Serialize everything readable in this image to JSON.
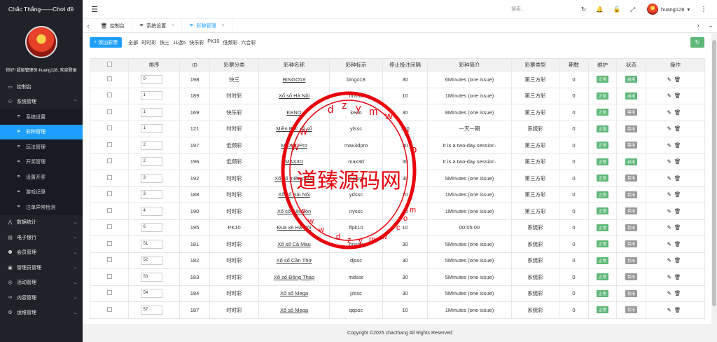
{
  "app": {
    "title": "Chắc Thắng——Chơi đề"
  },
  "sidebar": {
    "welcome": "你好! 超级管理员-huang128, 欢迎登录",
    "items": [
      {
        "label": "控制台",
        "icon": "monitor-icon",
        "expandable": false
      },
      {
        "label": "系统管理",
        "icon": "user-icon",
        "expandable": true,
        "expanded": true
      },
      {
        "label": "系统设置",
        "sub": true
      },
      {
        "label": "彩种管理",
        "sub": true,
        "active": true
      },
      {
        "label": "玩法管理",
        "sub": true
      },
      {
        "label": "开奖管理",
        "sub": true
      },
      {
        "label": "设置开奖",
        "sub": true
      },
      {
        "label": "游戏记录",
        "sub": true
      },
      {
        "label": "注单异常检测",
        "sub": true
      },
      {
        "label": "数据统计",
        "icon": "chart-icon",
        "expandable": true
      },
      {
        "label": "电子银行",
        "icon": "bank-icon",
        "expandable": true
      },
      {
        "label": "会员管理",
        "icon": "members-icon",
        "expandable": true
      },
      {
        "label": "管理员管理",
        "icon": "admin-icon",
        "expandable": true
      },
      {
        "label": "活动管理",
        "icon": "gift-icon",
        "expandable": true
      },
      {
        "label": "内容管理",
        "icon": "link-icon",
        "expandable": true
      },
      {
        "label": "运维管理",
        "icon": "tools-icon",
        "expandable": true
      }
    ]
  },
  "header": {
    "search_placeholder": "搜索...",
    "username": "huang128"
  },
  "tabs": [
    {
      "label": "控制台",
      "closable": false,
      "active": false
    },
    {
      "label": "系统设置",
      "closable": true,
      "active": false
    },
    {
      "label": "彩种管理",
      "closable": true,
      "active": true
    }
  ],
  "toolbar": {
    "add_label": "添加彩票",
    "filters": [
      "全部",
      "时时彩",
      "快三",
      "11选5",
      "快乐彩",
      "PK10",
      "低频彩",
      "六合彩"
    ]
  },
  "table": {
    "headers": [
      "排序",
      "ID",
      "彩票分类",
      "彩种名称",
      "彩种标示",
      "停止投注间隔",
      "彩种简介",
      "彩票类型",
      "期数",
      "维护",
      "状态",
      "操作"
    ],
    "rows": [
      {
        "sort": "0",
        "id": "198",
        "cat": "快三",
        "name": "BINGO18",
        "code": "bingo18",
        "stop": "30",
        "intro": "6Minutes (one issue)",
        "type": "第三方彩",
        "issues": "0",
        "maint": "正常",
        "status": "启用",
        "status_on": true
      },
      {
        "sort": "1",
        "id": "189",
        "cat": "时时彩",
        "name": "Xổ số Hà Nội",
        "code": "hnssc",
        "stop": "10",
        "intro": "1Minutes (one issue)",
        "type": "第三方彩",
        "issues": "0",
        "maint": "正常",
        "status": "启用",
        "status_on": true
      },
      {
        "sort": "1",
        "id": "169",
        "cat": "快乐彩",
        "name": "KENO",
        "code": "keno",
        "stop": "30",
        "intro": "8Minutes (one issue)",
        "type": "第三方彩",
        "issues": "0",
        "maint": "正常",
        "status": "禁用",
        "status_on": false
      },
      {
        "sort": "1",
        "id": "121",
        "cat": "时时彩",
        "name": "Miền Bắc xổ số",
        "code": "yfssc",
        "stop": "300",
        "intro": "一天一期",
        "type": "系统彩",
        "issues": "0",
        "maint": "正常",
        "status": "禁用",
        "status_on": false
      },
      {
        "sort": "2",
        "id": "197",
        "cat": "低频彩",
        "name": "MAX3DPro",
        "code": "max3dpro",
        "stop": "30",
        "intro": "It is a two-day session.",
        "type": "第三方彩",
        "issues": "0",
        "maint": "正常",
        "status": "禁用",
        "status_on": false
      },
      {
        "sort": "2",
        "id": "196",
        "cat": "低频彩",
        "name": "MAX3D",
        "code": "max3d",
        "stop": "30",
        "intro": "It is a two-day session.",
        "type": "第三方彩",
        "issues": "0",
        "maint": "正常",
        "status": "启用",
        "status_on": true
      },
      {
        "sort": "3",
        "id": "192",
        "cat": "时时彩",
        "name": "Xổ số miền phúc",
        "code": "mpssc",
        "stop": "30",
        "intro": "5Minutes (one issue)",
        "type": "第三方彩",
        "issues": "0",
        "maint": "正常",
        "status": "禁用",
        "status_on": false
      },
      {
        "sort": "3",
        "id": "188",
        "cat": "时时彩",
        "name": "Xổ số Sài Nội",
        "code": "ydssc",
        "stop": "10",
        "intro": "1Minutes (one issue)",
        "type": "第三方彩",
        "issues": "0",
        "maint": "正常",
        "status": "禁用",
        "status_on": false
      },
      {
        "sort": "4",
        "id": "190",
        "cat": "时时彩",
        "name": "Xổ số Sài Gòn",
        "code": "nyssc",
        "stop": "10",
        "intro": "1Minutes (one issue)",
        "type": "第三方彩",
        "issues": "0",
        "maint": "正常",
        "status": "禁用",
        "status_on": false
      },
      {
        "sort": "6",
        "id": "195",
        "cat": "PK10",
        "name": "Đua xe Hà Nội",
        "code": "lfpk10",
        "stop": "10",
        "intro": "00:05:00",
        "type": "系统彩",
        "issues": "0",
        "maint": "正常",
        "status": "禁用",
        "status_on": false
      },
      {
        "sort": "51",
        "id": "181",
        "cat": "时时彩",
        "name": "Xổ số Cà Mau",
        "code": "hnssc",
        "stop": "30",
        "intro": "5Minutes (one issue)",
        "type": "系统彩",
        "issues": "0",
        "maint": "正常",
        "status": "禁用",
        "status_on": false
      },
      {
        "sort": "52",
        "id": "182",
        "cat": "时时彩",
        "name": "Xổ số Cần Thơ",
        "code": "djssc",
        "stop": "30",
        "intro": "5Minutes (one issue)",
        "type": "系统彩",
        "issues": "0",
        "maint": "正常",
        "status": "禁用",
        "status_on": false
      },
      {
        "sort": "53",
        "id": "183",
        "cat": "时时彩",
        "name": "Xổ số Đồng Tháp",
        "code": "mdssc",
        "stop": "30",
        "intro": "5Minutes (one issue)",
        "type": "系统彩",
        "issues": "0",
        "maint": "正常",
        "status": "禁用",
        "status_on": false
      },
      {
        "sort": "54",
        "id": "184",
        "cat": "时时彩",
        "name": "Xổ số Mega",
        "code": "jzssc",
        "stop": "30",
        "intro": "5Minutes (one issue)",
        "type": "系统彩",
        "issues": "0",
        "maint": "正常",
        "status": "禁用",
        "status_on": false
      },
      {
        "sort": "57",
        "id": "187",
        "cat": "时时彩",
        "name": "Xổ số Mega",
        "code": "qqssc",
        "stop": "10",
        "intro": "1Minutes (one issue)",
        "type": "系统彩",
        "issues": "0",
        "maint": "正常",
        "status": "禁用",
        "status_on": false
      }
    ]
  },
  "footer": {
    "text": "Copyright ©2025 chacthang All Rights Reserved"
  },
  "watermark": {
    "text": "道臻源码网",
    "url": "www.dzym.com"
  },
  "colors": {
    "accent": "#1e9fff",
    "sidebar_bg": "#20222a",
    "green": "#5fb878",
    "watermark": "#e8000b"
  }
}
